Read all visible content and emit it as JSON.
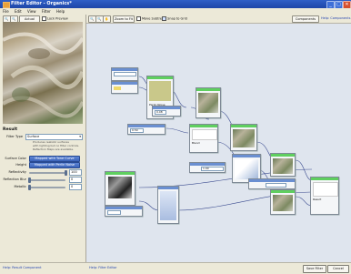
{
  "window": {
    "title": "Filter Editor - Organics*"
  },
  "menu": {
    "file": "File",
    "edit": "Edit",
    "view": "View",
    "filter": "Filter",
    "help": "Help"
  },
  "left": {
    "actual_pixels": "Actual Pixels",
    "lock_preview": "Lock Preview",
    "result_title": "Result",
    "filter_type_label": "Filter Type",
    "filter_type_value": "Surface",
    "description": [
      "Produces realistic surfaces",
      "with lighting but no filter controls.",
      "Reflection Maps are available."
    ],
    "surface_color_label": "Surface Color",
    "surface_color_btn": "Mapped with Tone Curve",
    "height_label": "Height",
    "height_btn": "Mapped with Perlin Noise",
    "reflectivity_label": "Reflectivity",
    "reflectivity_value": "100",
    "reflection_blur_label": "Reflection Blur",
    "reflection_blur_value": "0",
    "metallic_label": "Metallic",
    "metallic_value": "0"
  },
  "levels": {
    "reflectivity": 1.0,
    "reflection_blur": 0.0,
    "metallic": 0.0
  },
  "canvas": {
    "zoom_to_fit": "Zoom to Fit",
    "move_subtree": "Move Subtree",
    "snap_to_grid": "Snap to Grid",
    "components": "Components",
    "help_components": "Help: Components"
  },
  "nodes": {
    "perlin_label": "Perlin Noise",
    "blend_label": "Blend",
    "tone_curve_label": "Tone Curve",
    "result_label": "Result",
    "value_a": "0.08",
    "value_b": "0.50",
    "value_c": "1.00"
  },
  "status": {
    "help_result": "Help: Result Component",
    "help_filter": "Help: Filter Editor",
    "save_filter": "Save Filter",
    "cancel": "Cancel"
  },
  "colors": {
    "accent": "#2f5fc7",
    "node_green": "#5fcf5f",
    "node_blue": "#6a8fd1"
  }
}
